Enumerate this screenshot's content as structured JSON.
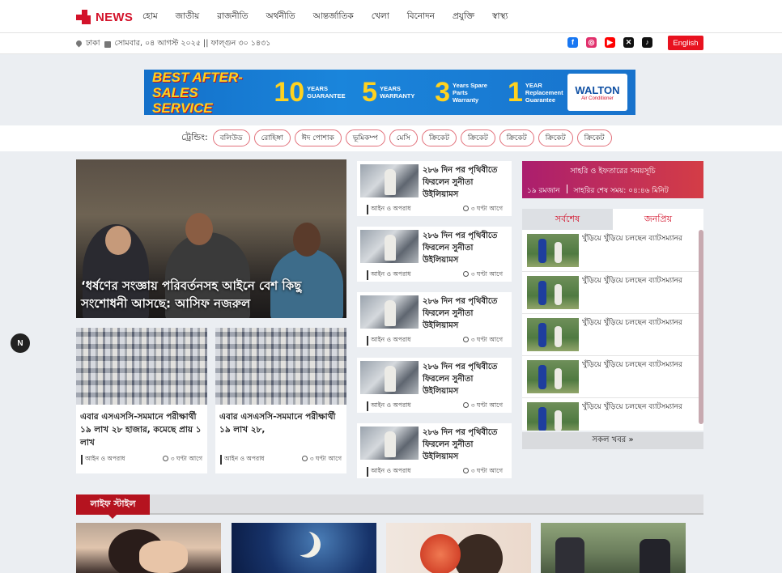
{
  "brand": {
    "logo_text": "NEWS",
    "accent": "#d3122a"
  },
  "nav": {
    "items": [
      "হোম",
      "জাতীয়",
      "রাজনীতি",
      "অর্থনীতি",
      "আন্তর্জাতিক",
      "খেলা",
      "বিনোদন",
      "প্রযুক্তি",
      "স্বাস্থ্য"
    ]
  },
  "infobar": {
    "location": "ঢাকা",
    "date": "সোমবার, ০৪ আগস্ট ২০২৫ || ফাল্গুন ৩০ ১৪৩১",
    "language_button": "English",
    "social": [
      {
        "icon": "facebook-icon",
        "glyph": "f",
        "color": "#1877f2"
      },
      {
        "icon": "instagram-icon",
        "glyph": "◎",
        "color": "#e1306c"
      },
      {
        "icon": "youtube-icon",
        "glyph": "▶",
        "color": "#ff0000"
      },
      {
        "icon": "twitter-icon",
        "glyph": "✕",
        "color": "#111111"
      },
      {
        "icon": "tiktok-icon",
        "glyph": "♪",
        "color": "#111111"
      }
    ]
  },
  "ad": {
    "headline": "BEST AFTER-SALES SERVICE",
    "block1_num": "10",
    "block1_text": "YEARS GUARANTEE",
    "block2_num": "5",
    "block2_text": "YEARS WARRANTY",
    "block3_num": "3",
    "block3_text": "Years Spare Parts Warranty",
    "block4_num": "1",
    "block4_text": "YEAR Replacement Guarantee",
    "brand": "WALTON",
    "brand_sub": "Air Conditioner"
  },
  "trending": {
    "label": "ট্রেন্ডিং:",
    "tags": [
      "বলিউড",
      "রোহিঙ্গা",
      "ঈদ পোশাক",
      "ভূমিকম্প",
      "মেসি",
      "ক্রিকেট",
      "ক্রিকেট",
      "ক্রিকেট",
      "ক্রিকেট",
      "ক্রিকেট"
    ]
  },
  "lead": {
    "title": "‘ধর্ষণের সংজ্ঞায় পরিবর্তনসহ আইনে বেশ কিছু সংশোধনী আসছে: আসিফ নজরুল"
  },
  "sub_cards": [
    {
      "title": "এবার এসএসসি-সমমানে পরীক্ষার্থী ১৯ লাখ ২৮ হাজার, কমেছে প্রায় ১ লাখ",
      "category": "আইন ও অপরাধ",
      "time": "৩ ঘণ্টা আগে"
    },
    {
      "title": "এবার এসএসসি-সমমানে পরীক্ষার্থী ১৯ লাখ ২৮,",
      "category": "আইন ও অপরাধ",
      "time": "৩ ঘণ্টা আগে"
    }
  ],
  "middle_list": [
    {
      "title": "২৮৬ দিন পর পৃথিবীতে ফিরলেন সুনীতা উইলিয়ামস",
      "category": "আইন ও অপরাধ",
      "time": "৩ ঘণ্টা আগে"
    },
    {
      "title": "২৮৬ দিন পর পৃথিবীতে ফিরলেন সুনীতা উইলিয়ামস",
      "category": "আইন ও অপরাধ",
      "time": "৩ ঘণ্টা আগে"
    },
    {
      "title": "২৮৬ দিন পর পৃথিবীতে ফিরলেন সুনীতা উইলিয়ামস",
      "category": "আইন ও অপরাধ",
      "time": "৩ ঘণ্টা আগে"
    },
    {
      "title": "২৮৬ দিন পর পৃথিবীতে ফিরলেন সুনীতা উইলিয়ামস",
      "category": "আইন ও অপরাধ",
      "time": "৩ ঘণ্টা আগে"
    },
    {
      "title": "২৮৬ দিন পর পৃথিবীতে ফিরলেন সুনীতা উইলিয়ামস",
      "category": "আইন ও অপরাধ",
      "time": "৩ ঘণ্টা আগে"
    }
  ],
  "iftar": {
    "title": "সাহরি ও ইফতারের সময়সূচি",
    "day": "১৯ রমজান",
    "sahri": "সাহরির শেষ সময়: ০৪:৪৬ মিনিট"
  },
  "side_tabs": {
    "latest": "সর্বশেষ",
    "popular": "জনপ্রিয়"
  },
  "side_list": [
    "খুঁড়িয়ে খুঁড়িয়ে চলছেন ব্যাটসম্যানর",
    "খুঁড়িয়ে খুঁড়িয়ে চলছেন ব্যাটসম্যানর",
    "খুঁড়িয়ে খুঁড়িয়ে চলছেন ব্যাটসম্যানর",
    "খুঁড়িয়ে খুঁড়িয়ে চলছেন ব্যাটসম্যানর",
    "খুঁড়িয়ে খুঁড়িয়ে চলছেন ব্যাটসম্যানর"
  ],
  "all_news": "সকল খবর »",
  "float_button": "N",
  "lifestyle": {
    "label": "লাইফ স্টাইল"
  }
}
